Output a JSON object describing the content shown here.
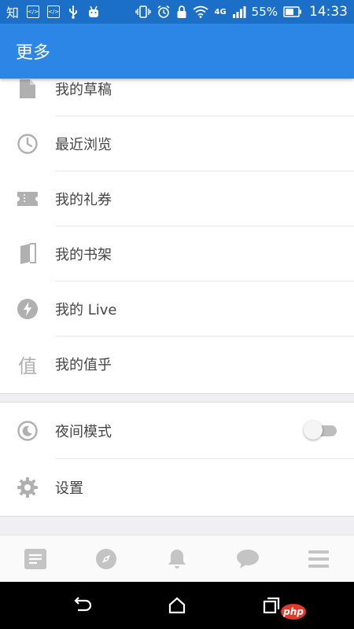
{
  "status_bar": {
    "app_glyph": "知",
    "battery": "55%",
    "time": "14:33",
    "network": "4G"
  },
  "app_bar": {
    "title": "更多"
  },
  "menu": {
    "items": [
      {
        "label": "我的草稿",
        "icon": "document-icon"
      },
      {
        "label": "最近浏览",
        "icon": "clock-icon"
      },
      {
        "label": "我的礼券",
        "icon": "coupon-icon"
      },
      {
        "label": "我的书架",
        "icon": "book-icon"
      },
      {
        "label": "我的 Live",
        "icon": "lightning-icon"
      },
      {
        "label": "我的值乎",
        "icon": "zhihu-value-icon",
        "glyph": "值"
      }
    ],
    "settings": [
      {
        "label": "夜间模式",
        "icon": "moon-icon",
        "toggle": false
      },
      {
        "label": "设置",
        "icon": "gear-icon"
      }
    ]
  },
  "bottom_nav": [
    "feed-icon",
    "compass-icon",
    "bell-icon",
    "chat-bubble-icon",
    "menu-icon"
  ],
  "watermark": "php",
  "colors": {
    "status": "#1b6fc7",
    "appbar": "#2b86e6",
    "icon": "#b0b0b0"
  }
}
